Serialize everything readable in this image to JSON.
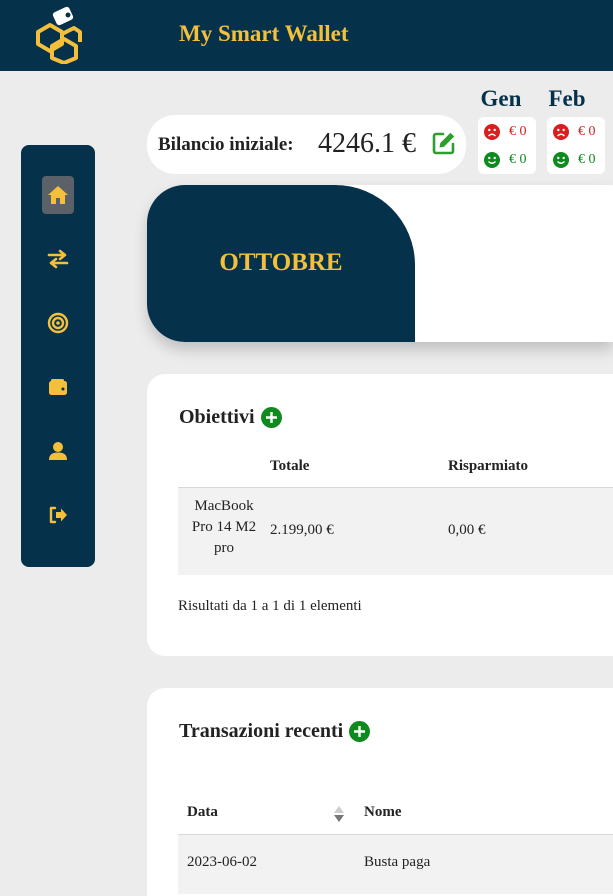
{
  "header": {
    "title": "My Smart Wallet",
    "logo_icon": "hexagon-wallet-logo-icon"
  },
  "colors": {
    "navy": "#06314b",
    "gold": "#f4bf3a",
    "negative": "#d81f1f",
    "positive": "#0f8a1f"
  },
  "sidebar": {
    "items": [
      {
        "icon": "home-icon",
        "active": true
      },
      {
        "icon": "transfer-arrows-icon"
      },
      {
        "icon": "target-icon"
      },
      {
        "icon": "wallet-icon"
      },
      {
        "icon": "user-icon"
      },
      {
        "icon": "logout-icon"
      }
    ]
  },
  "balance": {
    "label": "Bilancio iniziale:",
    "value": "4246.1 €",
    "edit_icon": "edit-icon"
  },
  "months": [
    {
      "name": "Gen",
      "expense": "€ 0",
      "income": "€ 0"
    },
    {
      "name": "Feb",
      "expense": "€ 0",
      "income": "€ 0"
    }
  ],
  "current_month": {
    "label": "OTTOBRE"
  },
  "goals": {
    "title": "Obiettivi",
    "add_icon": "plus-circle-icon",
    "columns": [
      "",
      "Totale",
      "Risparmiato"
    ],
    "rows": [
      {
        "name": "MacBook Pro 14 M2 pro",
        "total": "2.199,00 €",
        "saved": "0,00 €"
      }
    ],
    "footer": "Risultati da 1 a 1 di 1 elementi"
  },
  "transactions": {
    "title": "Transazioni recenti",
    "add_icon": "plus-circle-icon",
    "columns": [
      "Data",
      "Nome"
    ],
    "rows": [
      {
        "date": "2023-06-02",
        "name": "Busta paga"
      }
    ]
  }
}
